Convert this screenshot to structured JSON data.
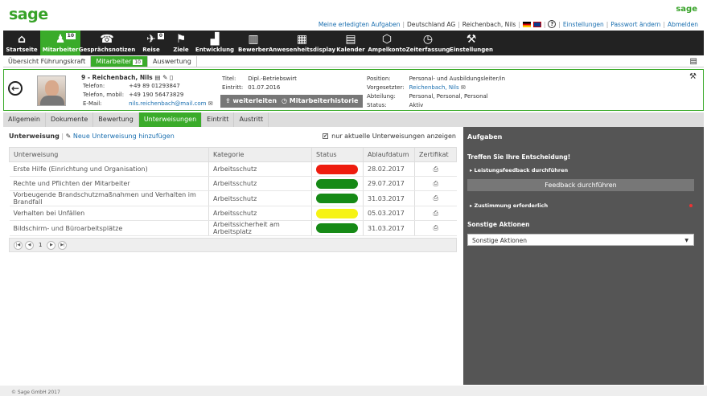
{
  "brand": {
    "logo": "sage",
    "logo_small": "sage"
  },
  "toplinks": {
    "done_tasks": "Meine erledigten Aufgaben",
    "company": "Deutschland AG",
    "user": "Reichenbach, Nils",
    "help": "?",
    "settings": "Einstellungen",
    "change_pw": "Passwort ändern",
    "logout": "Abmelden"
  },
  "nav": [
    {
      "label": "Startseite",
      "icon": "⌂"
    },
    {
      "label": "Mitarbeiter",
      "icon": "♟",
      "badge": "10"
    },
    {
      "label": "Gesprächsnotizen",
      "icon": "☎"
    },
    {
      "label": "Reise",
      "icon": "✈",
      "badge": "0"
    },
    {
      "label": "Ziele",
      "icon": "⚑"
    },
    {
      "label": "Entwicklung",
      "icon": "▟"
    },
    {
      "label": "Bewerber",
      "icon": "▥"
    },
    {
      "label": "Anwesenheitsdisplay",
      "icon": "▦"
    },
    {
      "label": "Kalender",
      "icon": "▤"
    },
    {
      "label": "Ampelkonto",
      "icon": "⬡"
    },
    {
      "label": "Zeiterfassung",
      "icon": "◷"
    },
    {
      "label": "Einstellungen",
      "icon": "⚒"
    }
  ],
  "tabs1": [
    {
      "label": "Übersicht Führungskraft"
    },
    {
      "label": "Mitarbeiter",
      "badge": "10"
    },
    {
      "label": "Auswertung"
    }
  ],
  "employee": {
    "name": "9 - Reichenbach, Nils",
    "phone_label": "Telefon:",
    "phone": "+49 89 01293847",
    "mobile_label": "Telefon, mobil:",
    "mobile": "+49 190 56473829",
    "email_label": "E-Mail:",
    "email": "nils.reichenbach@mail.com",
    "title_label": "Titel:",
    "title": "Dipl.-Betriebswirt",
    "entry_label": "Eintritt:",
    "entry": "01.07.2016",
    "position_label": "Position:",
    "position": "Personal- und Ausbildungsleiter/in",
    "supervisor_label": "Vorgesetzter:",
    "supervisor": "Reichenbach, Nils",
    "department_label": "Abteilung:",
    "department": "Personal, Personal, Personal",
    "status_label": "Status:",
    "status": "Aktiv",
    "forward_btn": "weiterleiten",
    "history_btn": "Mitarbeiterhistorie"
  },
  "tabs2": [
    {
      "label": "Allgemein"
    },
    {
      "label": "Dokumente"
    },
    {
      "label": "Bewertung"
    },
    {
      "label": "Unterweisungen"
    },
    {
      "label": "Eintritt"
    },
    {
      "label": "Austritt"
    }
  ],
  "main": {
    "title": "Unterweisung",
    "add_link": "Neue Unterweisung hinzufügen",
    "only_current": "nur aktuelle Unterweisungen anzeigen",
    "columns": [
      "Unterweisung",
      "Kategorie",
      "Status",
      "Ablaufdatum",
      "Zertifikat"
    ],
    "rows": [
      {
        "name": "Erste Hilfe (Einrichtung und Organisation)",
        "category": "Arbeitsschutz",
        "status": "red",
        "date": "28.02.2017"
      },
      {
        "name": "Rechte und Pflichten der Mitarbeiter",
        "category": "Arbeitsschutz",
        "status": "green",
        "date": "29.07.2017"
      },
      {
        "name": "Vorbeugende Brandschutzmaßnahmen und Verhalten im Brandfall",
        "category": "Arbeitsschutz",
        "status": "green",
        "date": "31.03.2017"
      },
      {
        "name": "Verhalten bei Unfällen",
        "category": "Arbeitsschutz",
        "status": "yellow",
        "date": "05.03.2017"
      },
      {
        "name": "Bildschirm- und Büroarbeitsplätze",
        "category": "Arbeitssicherheit am Arbeitsplatz",
        "status": "green",
        "date": "31.03.2017"
      }
    ],
    "page": "1"
  },
  "colors": {
    "red": "#ee1c0e",
    "green": "#168a16",
    "yellow": "#f6f314",
    "accent": "#3aab2a"
  },
  "side": {
    "title": "Aufgaben",
    "decide": "Treffen Sie Ihre Entscheidung!",
    "feedback_item": "Leistungsfeedback durchführen",
    "feedback_btn": "Feedback durchführen",
    "consent_item": "Zustimmung erforderlich",
    "other_title": "Sonstige Aktionen",
    "other_select": "Sonstige Aktionen"
  },
  "footer": "© Sage GmbH 2017"
}
